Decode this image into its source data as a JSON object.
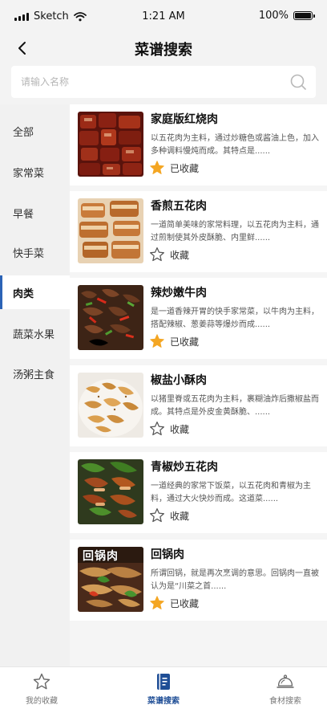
{
  "status_bar": {
    "carrier": "Sketch",
    "time": "1:21 AM",
    "battery": "100%"
  },
  "header": {
    "title": "菜谱搜索"
  },
  "search": {
    "placeholder": "请输入名称",
    "value": ""
  },
  "sidebar": {
    "items": [
      {
        "label": "全部",
        "active": false
      },
      {
        "label": "家常菜",
        "active": false
      },
      {
        "label": "早餐",
        "active": false
      },
      {
        "label": "快手菜",
        "active": false
      },
      {
        "label": "肉类",
        "active": true
      },
      {
        "label": "蔬菜水果",
        "active": false
      },
      {
        "label": "汤粥主食",
        "active": false
      }
    ]
  },
  "recipes": [
    {
      "title": "家庭版红烧肉",
      "desc": "以五花肉为主料，通过炒糖色或酱油上色，加入多种调料慢炖而成。其特点是......",
      "fav_label": "已收藏",
      "favorited": true,
      "fav_icon": "star-filled-icon"
    },
    {
      "title": "香煎五花肉",
      "desc": "一道简单美味的家常料理，以五花肉为主料，通过煎制使其外皮酥脆、内里鲜......",
      "fav_label": "收藏",
      "favorited": false,
      "fav_icon": "star-outline-icon"
    },
    {
      "title": "辣炒嫩牛肉",
      "desc": "是一道香辣开胃的快手家常菜，以牛肉为主料，搭配辣椒、葱姜蒜等爆炒而成......",
      "fav_label": "已收藏",
      "favorited": true,
      "fav_icon": "star-filled-icon"
    },
    {
      "title": "椒盐小酥肉",
      "desc": "以猪里脊或五花肉为主料，裹糊油炸后撒椒盐而成。其特点是外皮金黄酥脆、......",
      "fav_label": "收藏",
      "favorited": false,
      "fav_icon": "star-outline-icon"
    },
    {
      "title": "青椒炒五花肉",
      "desc": "一道经典的家常下饭菜，以五花肉和青椒为主料，通过大火快炒而成。这道菜......",
      "fav_label": "收藏",
      "favorited": false,
      "fav_icon": "star-outline-icon"
    },
    {
      "title": "回锅肉",
      "desc": "所谓回锅，就是再次烹调的意思。回锅肉一直被认为是“川菜之首......",
      "fav_label": "已收藏",
      "favorited": true,
      "fav_icon": "star-filled-icon",
      "image_caption": "回锅肉"
    }
  ],
  "tabbar": {
    "tabs": [
      {
        "label": "我的收藏",
        "icon": "star-outline-icon",
        "active": false
      },
      {
        "label": "菜谱搜索",
        "icon": "recipe-book-icon",
        "active": true
      },
      {
        "label": "食材搜索",
        "icon": "cloche-icon",
        "active": false
      }
    ]
  },
  "colors": {
    "accent": "#1f4e96",
    "active_indicator": "#2b63b6",
    "star_filled": "#f4a623",
    "sidebar_bg": "#f1f1f1",
    "header_bg": "#f3f3f3"
  }
}
